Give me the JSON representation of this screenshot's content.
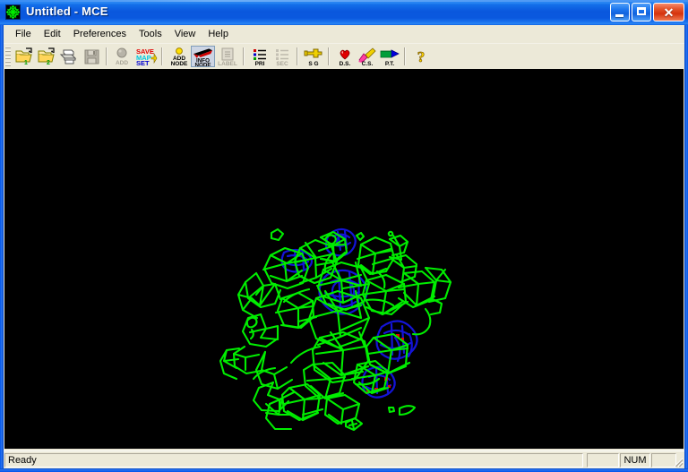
{
  "window": {
    "title": "Untitled - MCE",
    "app_icon": "mesh-icon",
    "accent_title_color": "#0a57dd",
    "client_bg": "#ece9d8",
    "buttons": {
      "minimize": "Minimize",
      "maximize": "Maximize",
      "close": "Close"
    }
  },
  "menubar": {
    "items": [
      {
        "label": "File"
      },
      {
        "label": "Edit"
      },
      {
        "label": "Preferences"
      },
      {
        "label": "Tools"
      },
      {
        "label": "View"
      },
      {
        "label": "Help"
      }
    ]
  },
  "toolbar": {
    "groups": [
      {
        "buttons": [
          {
            "name": "open-map-1-button",
            "icon": "folder-open-1-icon",
            "label": "1",
            "enabled": true,
            "pressed": false
          },
          {
            "name": "open-map-2-button",
            "icon": "folder-open-2-icon",
            "label": "2",
            "enabled": true,
            "pressed": false
          },
          {
            "name": "print-button",
            "icon": "printer-icon",
            "label": "",
            "enabled": true,
            "pressed": false
          },
          {
            "name": "save-button",
            "icon": "floppy-disk-icon",
            "label": "",
            "enabled": false,
            "pressed": false
          }
        ]
      },
      {
        "buttons": [
          {
            "name": "add-button",
            "icon": "add-sphere-icon",
            "label": "ADD",
            "enabled": false,
            "pressed": false
          },
          {
            "name": "save-map-set-button",
            "icon": "save-map-set-icon",
            "label": "SAVE MAP SET",
            "enabled": true,
            "pressed": false
          }
        ]
      },
      {
        "buttons": [
          {
            "name": "add-node-button",
            "icon": "add-node-icon",
            "label": "ADD NODE",
            "enabled": true,
            "pressed": false
          },
          {
            "name": "info-node-button",
            "icon": "info-node-icon",
            "label": "INFO NODE",
            "enabled": true,
            "pressed": true
          },
          {
            "name": "label-button",
            "icon": "label-icon",
            "label": "LABEL",
            "enabled": false,
            "pressed": false
          }
        ]
      },
      {
        "buttons": [
          {
            "name": "primary-list-button",
            "icon": "pri-list-icon",
            "label": "PRI",
            "enabled": true,
            "pressed": false
          },
          {
            "name": "secondary-list-button",
            "icon": "sec-list-icon",
            "label": "SEC",
            "enabled": false,
            "pressed": false
          }
        ]
      },
      {
        "buttons": [
          {
            "name": "sg-button",
            "icon": "clamp-icon",
            "label": "S G",
            "enabled": true,
            "pressed": false
          }
        ]
      },
      {
        "buttons": [
          {
            "name": "ds-button",
            "icon": "heart-icon",
            "label": "D.S.",
            "enabled": true,
            "pressed": false
          },
          {
            "name": "cs-button",
            "icon": "brush-icon",
            "label": "C.S.",
            "enabled": true,
            "pressed": false
          },
          {
            "name": "pt-button",
            "icon": "arrow-marker-icon",
            "label": "P.T.",
            "enabled": true,
            "pressed": false
          }
        ]
      },
      {
        "buttons": [
          {
            "name": "help-button",
            "icon": "question-mark-icon",
            "label": "",
            "enabled": true,
            "pressed": false
          }
        ]
      }
    ]
  },
  "canvas": {
    "name": "electron-density-viewport",
    "background_color": "#000000",
    "mesh_primary_color": "#00ee00",
    "mesh_secondary_color": "#1414d8",
    "mesh_accent_color": "#ee0000",
    "description": "Wireframe electron density map contours"
  },
  "statusbar": {
    "message": "Ready",
    "pane_a": "",
    "pane_b": "NUM",
    "pane_c": "",
    "resize_grip": "resize-grip-icon"
  }
}
